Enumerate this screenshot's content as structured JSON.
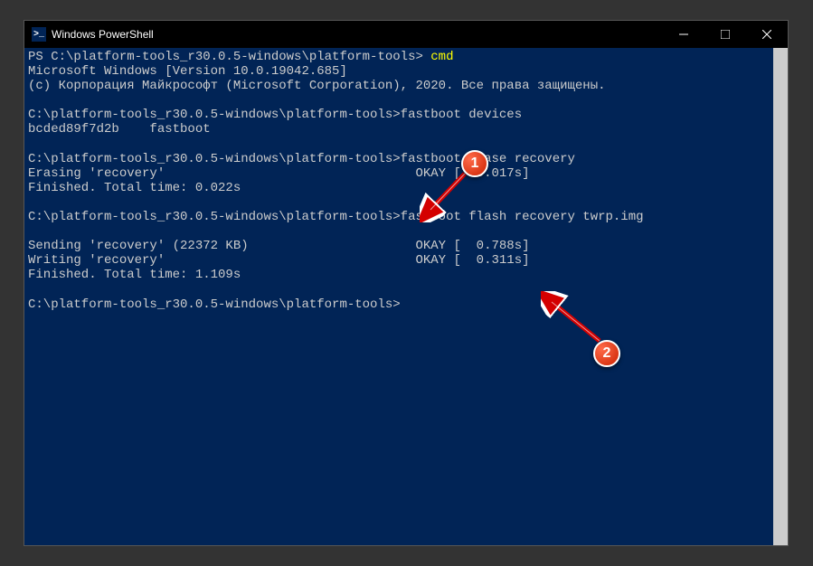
{
  "window": {
    "title": "Windows PowerShell"
  },
  "terminal": {
    "line1_prompt": "PS C:\\platform-tools_r30.0.5-windows\\platform-tools> ",
    "line1_cmd": "cmd",
    "line2": "Microsoft Windows [Version 10.0.19042.685]",
    "line3": "(c) Корпорация Майкрософт (Microsoft Corporation), 2020. Все права защищены.",
    "line5": "C:\\platform-tools_r30.0.5-windows\\platform-tools>fastboot devices",
    "line6": "bcded89f7d2b    fastboot",
    "line8": "C:\\platform-tools_r30.0.5-windows\\platform-tools>fastboot erase recovery",
    "line9": "Erasing 'recovery'                                 OKAY [  0.017s]",
    "line10": "Finished. Total time: 0.022s",
    "line12": "C:\\platform-tools_r30.0.5-windows\\platform-tools>fastboot flash recovery twrp.img",
    "line14": "Sending 'recovery' (22372 KB)                      OKAY [  0.788s]",
    "line15": "Writing 'recovery'                                 OKAY [  0.311s]",
    "line16": "Finished. Total time: 1.109s",
    "line18": "C:\\platform-tools_r30.0.5-windows\\platform-tools>"
  },
  "annotations": {
    "badge1": "1",
    "badge2": "2"
  }
}
